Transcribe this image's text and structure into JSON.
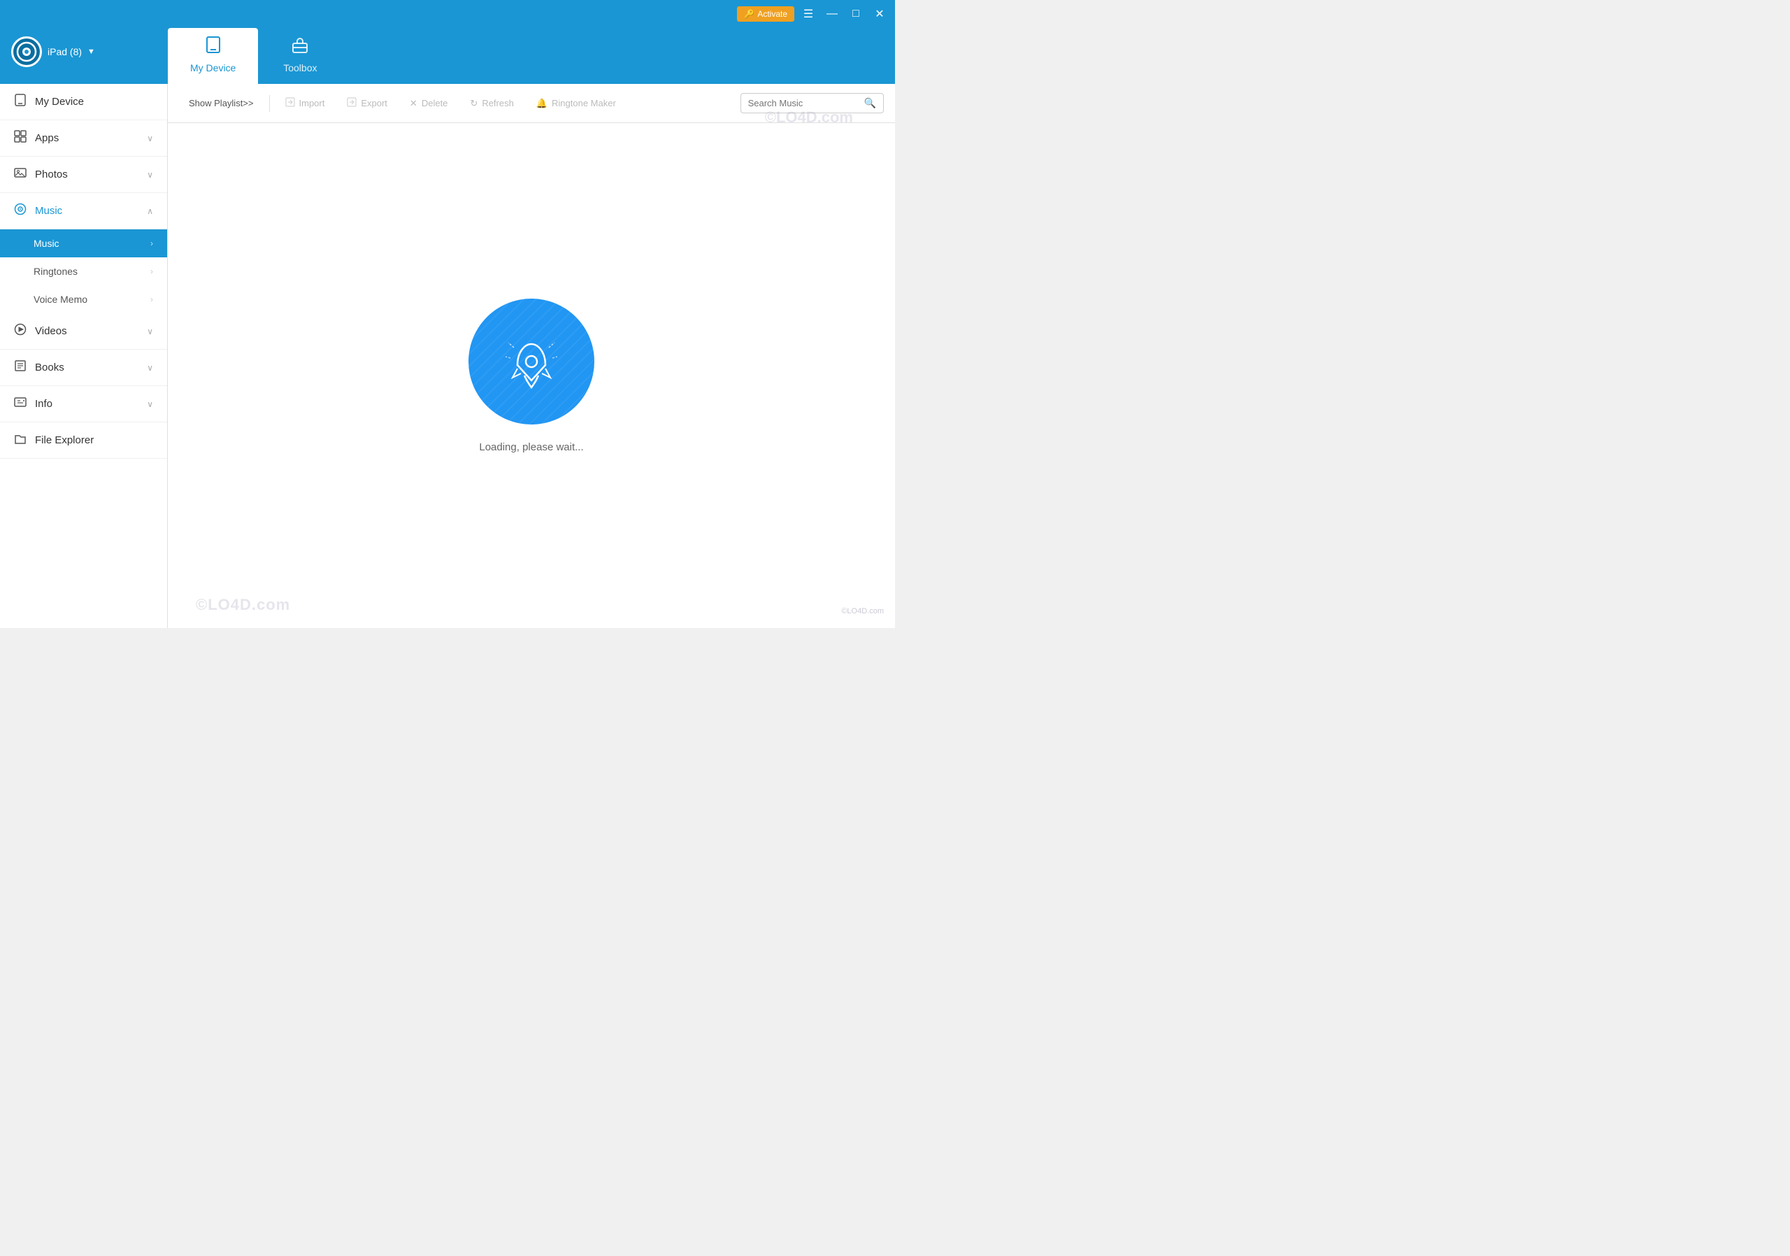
{
  "titlebar": {
    "activate_label": "Activate",
    "activate_icon": "🔑",
    "hamburger_icon": "☰",
    "minimize_icon": "—",
    "maximize_icon": "□",
    "close_icon": "✕"
  },
  "header": {
    "device_name": "iPad (8)",
    "device_arrow": "▼",
    "tabs": [
      {
        "id": "my-device",
        "label": "My Device",
        "icon": "📱",
        "active": true
      },
      {
        "id": "toolbox",
        "label": "Toolbox",
        "icon": "💼",
        "active": false
      }
    ]
  },
  "sidebar": {
    "items": [
      {
        "id": "my-device",
        "label": "My Device",
        "icon": "📱",
        "expandable": false
      },
      {
        "id": "apps",
        "label": "Apps",
        "icon": "⊞",
        "expandable": true
      },
      {
        "id": "photos",
        "label": "Photos",
        "icon": "🖼",
        "expandable": true
      },
      {
        "id": "music",
        "label": "Music",
        "icon": "🔄",
        "expandable": true,
        "active": true,
        "subitems": [
          {
            "id": "music-sub",
            "label": "Music",
            "active": true
          },
          {
            "id": "ringtones",
            "label": "Ringtones",
            "active": false
          },
          {
            "id": "voice-memo",
            "label": "Voice Memo",
            "active": false
          }
        ]
      },
      {
        "id": "videos",
        "label": "Videos",
        "icon": "▶",
        "expandable": true
      },
      {
        "id": "books",
        "label": "Books",
        "icon": "☰",
        "expandable": true
      },
      {
        "id": "info",
        "label": "Info",
        "icon": "💬",
        "expandable": true
      },
      {
        "id": "file-explorer",
        "label": "File Explorer",
        "icon": "🗂",
        "expandable": false
      }
    ]
  },
  "toolbar": {
    "show_playlist_label": "Show Playlist>>",
    "import_label": "Import",
    "export_label": "Export",
    "delete_label": "Delete",
    "refresh_label": "Refresh",
    "ringtone_maker_label": "Ringtone Maker",
    "search_placeholder": "Search Music"
  },
  "loading": {
    "text": "Loading, please wait..."
  },
  "watermark": {
    "text1": "©LO4D.com",
    "text2": "©LO4D.com",
    "logo": "©LO4D.com"
  }
}
